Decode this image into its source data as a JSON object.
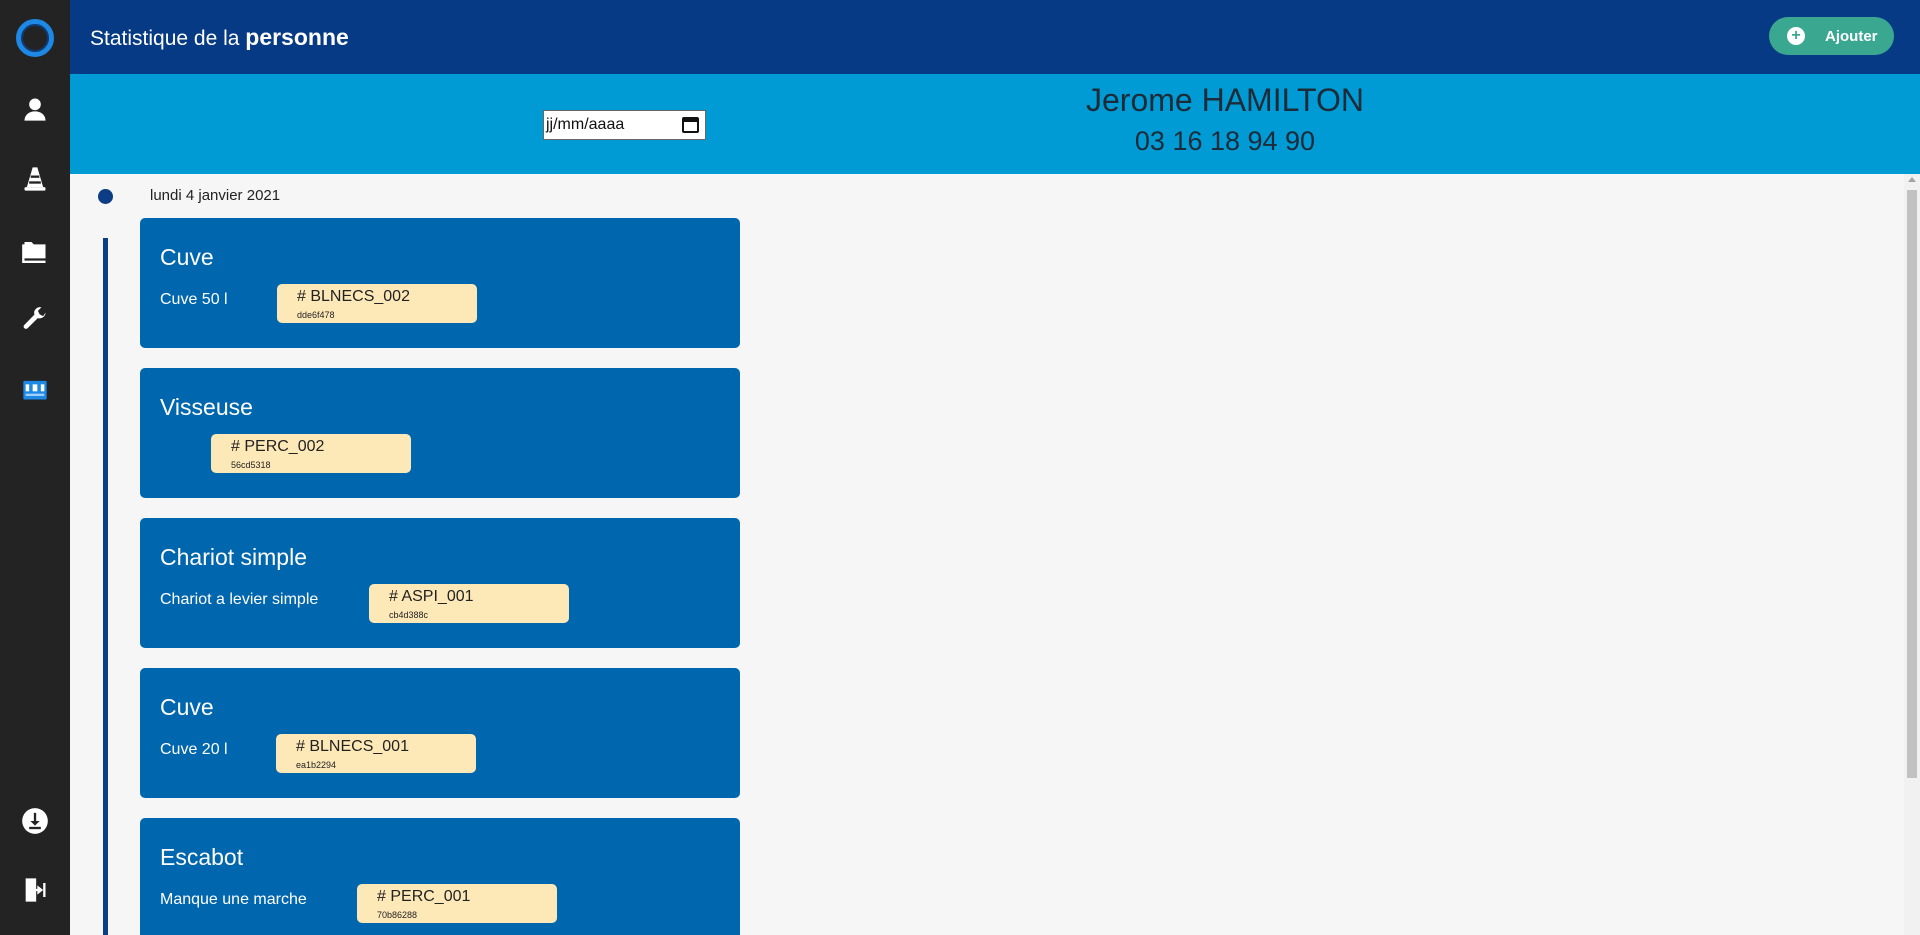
{
  "header": {
    "title_prefix": "Statistique de la ",
    "title_bold": "personne",
    "add_button_label": "Ajouter"
  },
  "sidebar": {
    "items": [
      {
        "icon": "user-icon"
      },
      {
        "icon": "traffic-cone-icon"
      },
      {
        "icon": "folder-icon"
      },
      {
        "icon": "wrench-icon"
      },
      {
        "icon": "toolbox-icon"
      },
      {
        "icon": "download-icon"
      },
      {
        "icon": "logout-icon"
      }
    ]
  },
  "filter": {
    "date_placeholder": "jj/mm/aaaa"
  },
  "person": {
    "name": "Jerome HAMILTON",
    "phone": "03 16 18 94 90"
  },
  "timeline": {
    "date": "lundi 4 janvier 2021",
    "cards": [
      {
        "title": "Cuve",
        "description": "Cuve 50 l",
        "tag_code": "# BLNECS_002",
        "tag_id": "dde6f478"
      },
      {
        "title": "Visseuse",
        "description": "",
        "tag_code": "# PERC_002",
        "tag_id": "56cd5318"
      },
      {
        "title": "Chariot simple",
        "description": "Chariot a levier simple",
        "tag_code": "# ASPI_001",
        "tag_id": "cb4d388c"
      },
      {
        "title": "Cuve",
        "description": "Cuve 20 l",
        "tag_code": "# BLNECS_001",
        "tag_id": "ea1b2294"
      },
      {
        "title": "Escabot",
        "description": "Manque une marche",
        "tag_code": "# PERC_001",
        "tag_id": "70b86288"
      }
    ]
  },
  "colors": {
    "sidebar": "#232323",
    "header": "#063a84",
    "banner": "#009bd5",
    "card": "#0066ad",
    "tag": "#fde8b8",
    "add_button": "#3aa891"
  }
}
